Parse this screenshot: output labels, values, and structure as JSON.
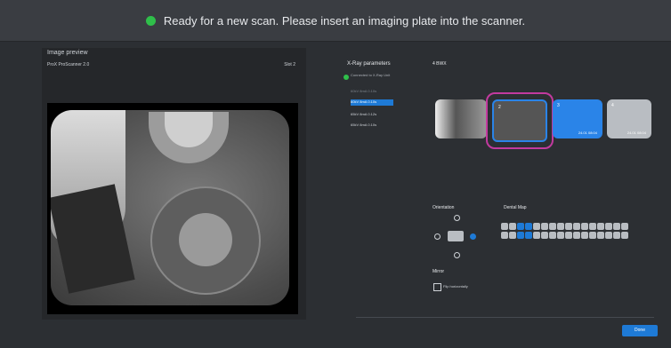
{
  "status": {
    "text": "Ready for a new scan. Please insert an imaging plate into the scanner."
  },
  "preview": {
    "title": "Image preview",
    "device": "ProX ProScanner 2.0",
    "slot": "Slot 2"
  },
  "xray": {
    "title": "X-Ray parameters",
    "connection": "Connected to X-Ray Unit",
    "params": [
      {
        "label": "60kV 8mA 0.10s",
        "state": "dim"
      },
      {
        "label": "60kV 8mA 0.10s",
        "state": "selected"
      },
      {
        "label": "65kV 8mA 0.12s",
        "state": "normal"
      },
      {
        "label": "65kV 8mA 0.10s",
        "state": "normal"
      }
    ]
  },
  "plate": {
    "label": "4 BWX"
  },
  "thumbs": [
    {
      "num": "",
      "time": ""
    },
    {
      "num": "2",
      "time": ""
    },
    {
      "num": "3",
      "time": "24.01 08:04"
    },
    {
      "num": "4",
      "time": "24.01 08:04"
    }
  ],
  "orientation": {
    "label": "Orientation"
  },
  "dental": {
    "label": "Dental Map"
  },
  "mirror": {
    "label": "Mirror",
    "checkbox_label": "Flip horizontally"
  },
  "buttons": {
    "done": "Done"
  },
  "colors": {
    "accent": "#1e7ad6",
    "highlight": "#c23a9f",
    "ready": "#2fbf4a"
  }
}
